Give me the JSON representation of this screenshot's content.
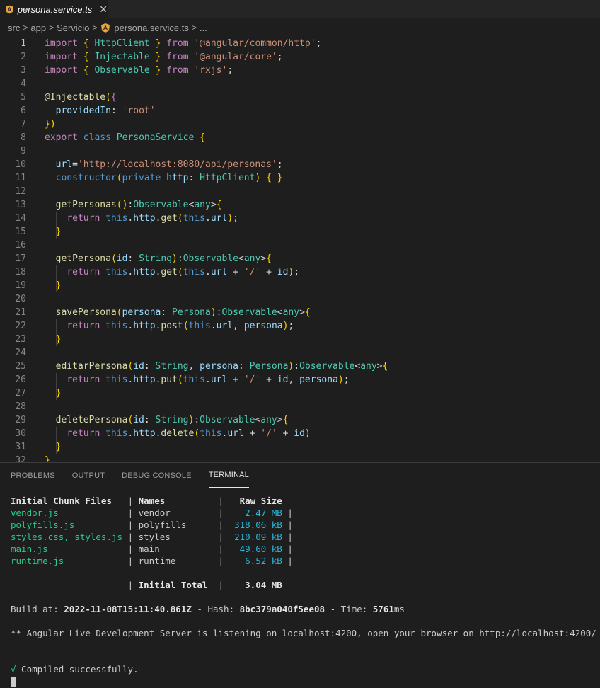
{
  "tab": {
    "label": "persona.service.ts",
    "close": "✕"
  },
  "breadcrumb": [
    "src",
    "app",
    "Servicio",
    "persona.service.ts",
    "..."
  ],
  "editor": {
    "active_line": 1,
    "line_numbers": [
      "1",
      "2",
      "3",
      "4",
      "5",
      "6",
      "7",
      "8",
      "9",
      "10",
      "11",
      "12",
      "13",
      "14",
      "15",
      "16",
      "17",
      "18",
      "19",
      "20",
      "21",
      "22",
      "23",
      "24",
      "25",
      "26",
      "27",
      "28",
      "29",
      "30",
      "31",
      "32"
    ],
    "lines": [
      "import { HttpClient } from '@angular/common/http';",
      "import { Injectable } from '@angular/core';",
      "import { Observable } from 'rxjs';",
      "",
      "@Injectable({",
      "  providedIn: 'root'",
      "})",
      "export class PersonaService {",
      "",
      "  url='http://localhost:8080/api/personas';",
      "  constructor(private http: HttpClient) { }",
      "",
      "  getPersonas():Observable<any>{",
      "    return this.http.get(this.url);",
      "  }",
      "",
      "  getPersona(id: String):Observable<any>{",
      "    return this.http.get(this.url + '/' + id);",
      "  }",
      "",
      "  savePersona(persona: Persona):Observable<any>{",
      "    return this.http.post(this.url, persona);",
      "  }",
      "",
      "  editarPersona(id: String, persona: Persona):Observable<any>{",
      "    return this.http.put(this.url + '/' + id, persona);",
      "  }",
      "",
      "  deletePersona(id: String):Observable<any>{",
      "    return this.http.delete(this.url + '/' + id)",
      "  }",
      "}"
    ]
  },
  "panel": {
    "tabs": [
      "PROBLEMS",
      "OUTPUT",
      "DEBUG CONSOLE",
      "TERMINAL"
    ],
    "active_tab": "TERMINAL"
  },
  "terminal": {
    "header": {
      "files": "Initial Chunk Files",
      "names": "Names",
      "size": "Raw Size"
    },
    "rows": [
      {
        "file": "vendor.js",
        "name": "vendor",
        "size": "2.47 MB"
      },
      {
        "file": "polyfills.js",
        "name": "polyfills",
        "size": "318.06 kB"
      },
      {
        "file": "styles.css, styles.js",
        "name": "styles",
        "size": "210.09 kB"
      },
      {
        "file": "main.js",
        "name": "main",
        "size": "49.60 kB"
      },
      {
        "file": "runtime.js",
        "name": "runtime",
        "size": "6.52 kB"
      }
    ],
    "total_label": "Initial Total",
    "total_value": "3.04 MB",
    "build_prefix": "Build at: ",
    "build_time": "2022-11-08T15:11:40.861Z",
    "hash_prefix": " - Hash: ",
    "hash": "8bc379a040f5ee08",
    "time_prefix": " - Time: ",
    "time_value": "5761",
    "time_unit": "ms",
    "server_message": "** Angular Live Development Server is listening on localhost:4200, open your browser on http://localhost:4200/ **",
    "compiled_check": "√",
    "compiled_message": " Compiled successfully."
  }
}
